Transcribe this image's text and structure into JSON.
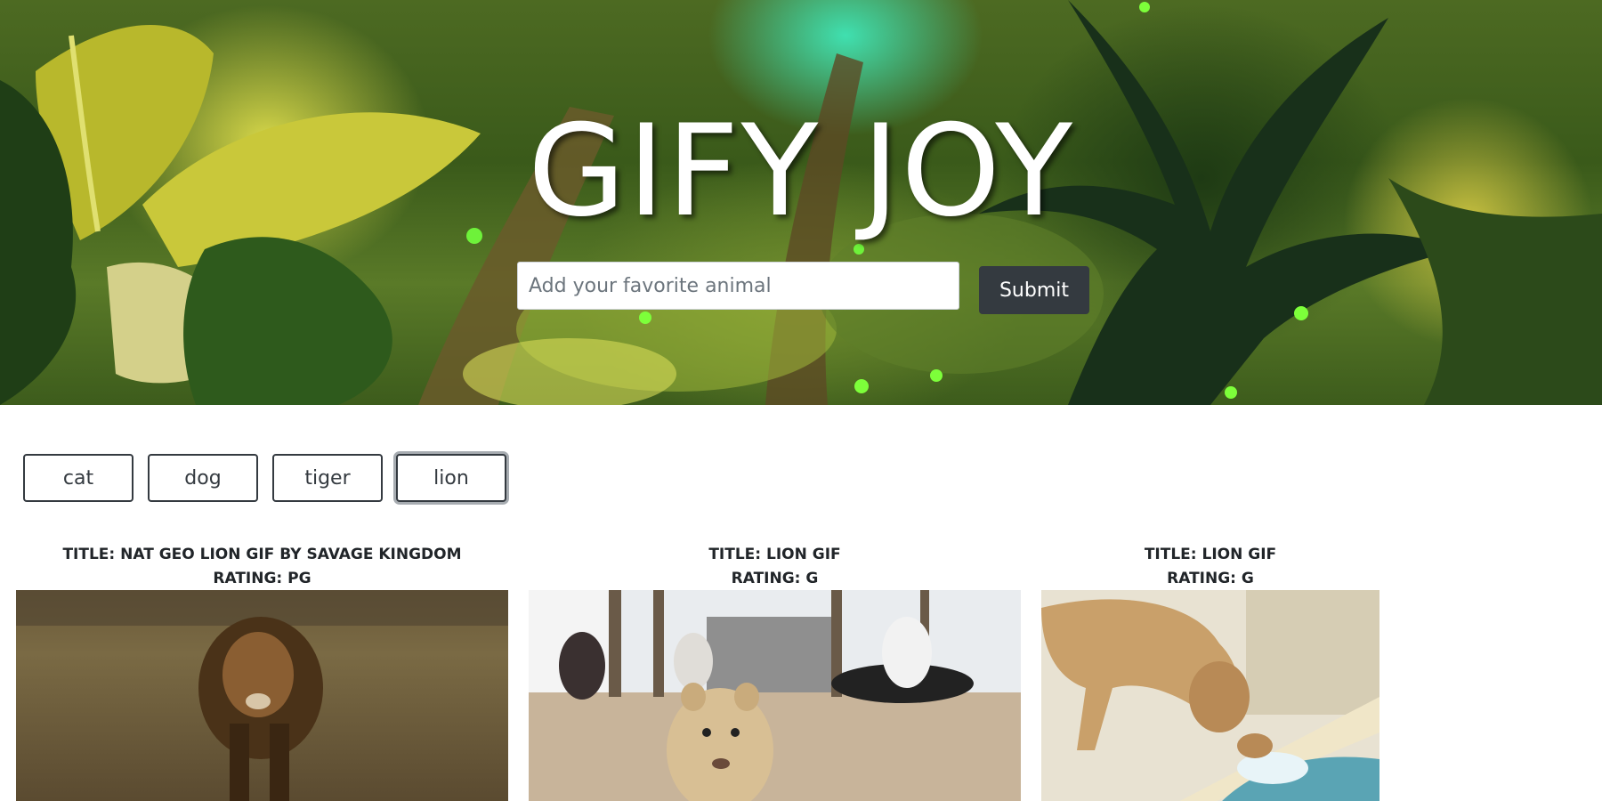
{
  "hero": {
    "title": "GIFY JOY",
    "search_placeholder": "Add your favorite animal",
    "submit_label": "Submit"
  },
  "animal_buttons": [
    {
      "label": "cat",
      "active": false
    },
    {
      "label": "dog",
      "active": false
    },
    {
      "label": "tiger",
      "active": false
    },
    {
      "label": "lion",
      "active": true
    }
  ],
  "gifs": [
    {
      "title": "TITLE: NAT GEO LION GIF BY SAVAGE KINGDOM",
      "rating": "RATING: PG"
    },
    {
      "title": "TITLE: LION GIF",
      "rating": "RATING: G"
    },
    {
      "title": "TITLE: LION GIF",
      "rating": "RATING: G"
    }
  ],
  "colors": {
    "dark_button": "#343a40",
    "text": "#212529"
  }
}
